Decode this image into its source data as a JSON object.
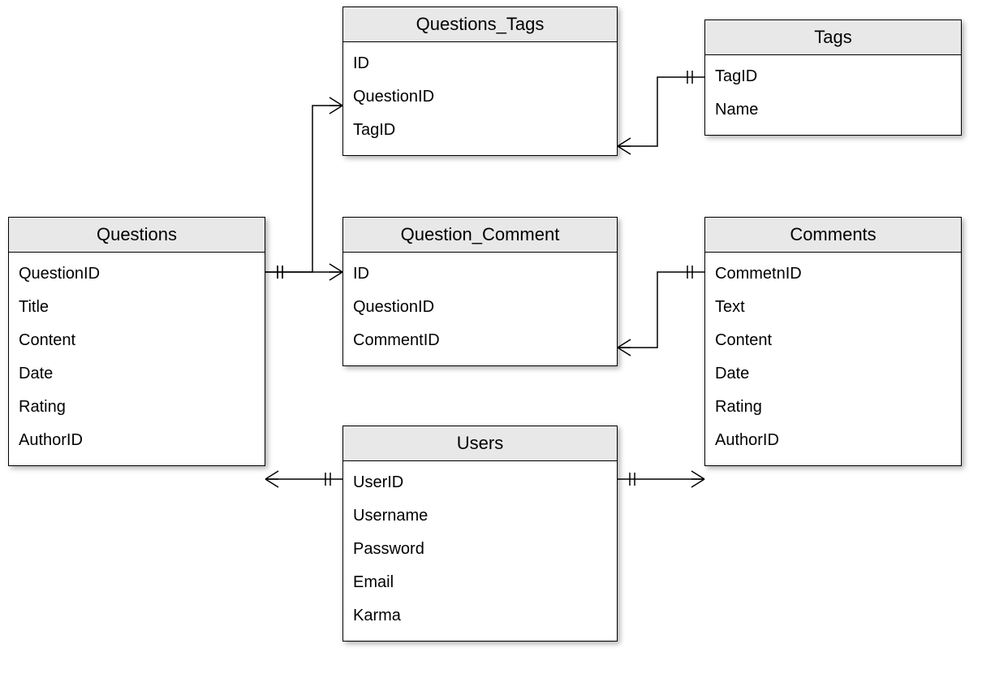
{
  "entities": {
    "questions": {
      "title": "Questions",
      "fields": [
        "QuestionID",
        "Title",
        "Content",
        "Date",
        "Rating",
        "AuthorID"
      ]
    },
    "questions_tags": {
      "title": "Questions_Tags",
      "fields": [
        "ID",
        "QuestionID",
        "TagID"
      ]
    },
    "tags": {
      "title": "Tags",
      "fields": [
        "TagID",
        "Name"
      ]
    },
    "question_comment": {
      "title": "Question_Comment",
      "fields": [
        "ID",
        "QuestionID",
        "CommentID"
      ]
    },
    "comments": {
      "title": "Comments",
      "fields": [
        "CommetnID",
        "Text",
        "Content",
        "Date",
        "Rating",
        "AuthorID"
      ]
    },
    "users": {
      "title": "Users",
      "fields": [
        "UserID",
        "Username",
        "Password",
        "Email",
        "Karma"
      ]
    }
  },
  "relationships": [
    {
      "from": "Questions",
      "to": "Questions_Tags",
      "type": "one-to-many"
    },
    {
      "from": "Tags",
      "to": "Questions_Tags",
      "type": "one-to-many"
    },
    {
      "from": "Questions",
      "to": "Question_Comment",
      "type": "one-to-many"
    },
    {
      "from": "Comments",
      "to": "Question_Comment",
      "type": "one-to-many"
    },
    {
      "from": "Users",
      "to": "Questions",
      "type": "one-to-many"
    },
    {
      "from": "Users",
      "to": "Comments",
      "type": "one-to-many"
    }
  ]
}
